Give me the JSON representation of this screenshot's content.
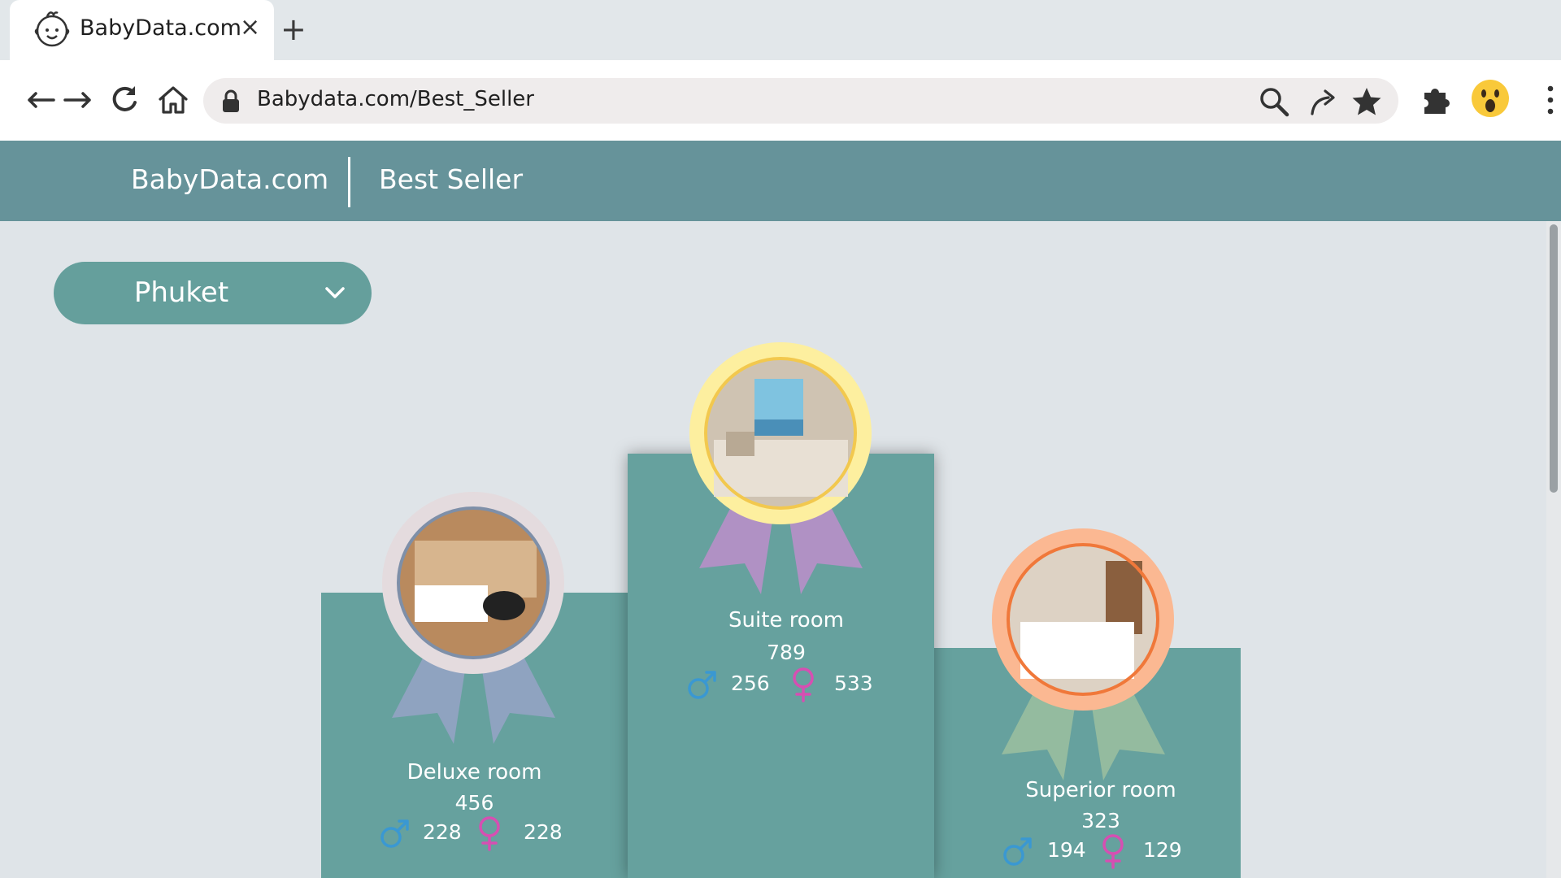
{
  "browser": {
    "tab_title": "BabyData.com",
    "tab_close": "×",
    "new_tab": "+",
    "url": "Babydata.com/Best_Seller"
  },
  "site": {
    "brand": "BabyData.com",
    "section": "Best Seller"
  },
  "location_select": {
    "selected": "Phuket"
  },
  "rooms": [
    {
      "rank": 2,
      "name": "Deluxe room",
      "total": "456",
      "male": "228",
      "female": "228",
      "ribbon_color": "#8fa3c0",
      "ring_color": "#e4dbde"
    },
    {
      "rank": 1,
      "name": "Suite room",
      "total": "789",
      "male": "256",
      "female": "533",
      "ribbon_color": "#b091c4",
      "ring_color": "#fdef9f"
    },
    {
      "rank": 3,
      "name": "Superior room",
      "total": "323",
      "male": "194",
      "female": "129",
      "ribbon_color": "#94bb9f",
      "ring_color": "#fbb892"
    }
  ],
  "colors": {
    "header": "#66939a",
    "podium": "#66a19e",
    "male_icon": "#3a98d2",
    "female_icon": "#d64fb2"
  }
}
